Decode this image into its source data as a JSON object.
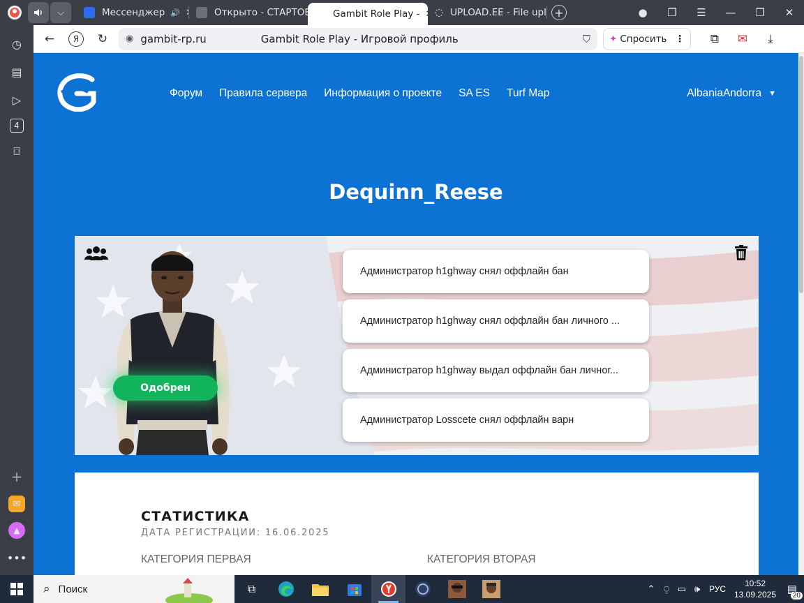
{
  "browser": {
    "tabs": [
      {
        "label": "Мессенджер",
        "favicon_color": "#2f6df0",
        "has_sound": true
      },
      {
        "label": "Открыто - СТАРТОВЫ",
        "favicon_color": "#6d6f78"
      },
      {
        "label": "Gambit Role Play -",
        "favicon_color": "#0c72d4",
        "active": true
      },
      {
        "label": "UPLOAD.EE - File uplo",
        "favicon_color": "#cccccc",
        "loading": true
      }
    ],
    "url": "gambit-rp.ru",
    "page_title": "Gambit Role Play - Игровой профиль",
    "ask_label": "Спросить",
    "sidebar_badge": "4"
  },
  "site": {
    "brand_color": "#0c72d4",
    "nav": [
      "Форум",
      "Правила сервера",
      "Информация о проекте",
      "SA ES",
      "Turf Map"
    ],
    "username": "AlbaniaAndorra",
    "profile_name": "Dequinn_Reese",
    "status": "Одобрен",
    "status_color": "#12b45c",
    "events": [
      "Администратор h1ghway снял оффлайн бан",
      "Администратор h1ghway снял оффлайн бан личного ...",
      "Администратор h1ghway выдал оффлайн бан личног...",
      "Администратор Losscete снял оффлайн варн"
    ],
    "stats": {
      "title": "СТАТИСТИКА",
      "registration": "ДАТА РЕГИСТРАЦИИ: 16.06.2025",
      "category_first": "КАТЕГОРИЯ ПЕРВАЯ",
      "category_second": "КАТЕГОРИЯ ВТОРАЯ"
    }
  },
  "taskbar": {
    "search_placeholder": "Поиск",
    "language": "РУС",
    "time": "10:52",
    "date": "13.09.2025",
    "notifications": "20"
  }
}
